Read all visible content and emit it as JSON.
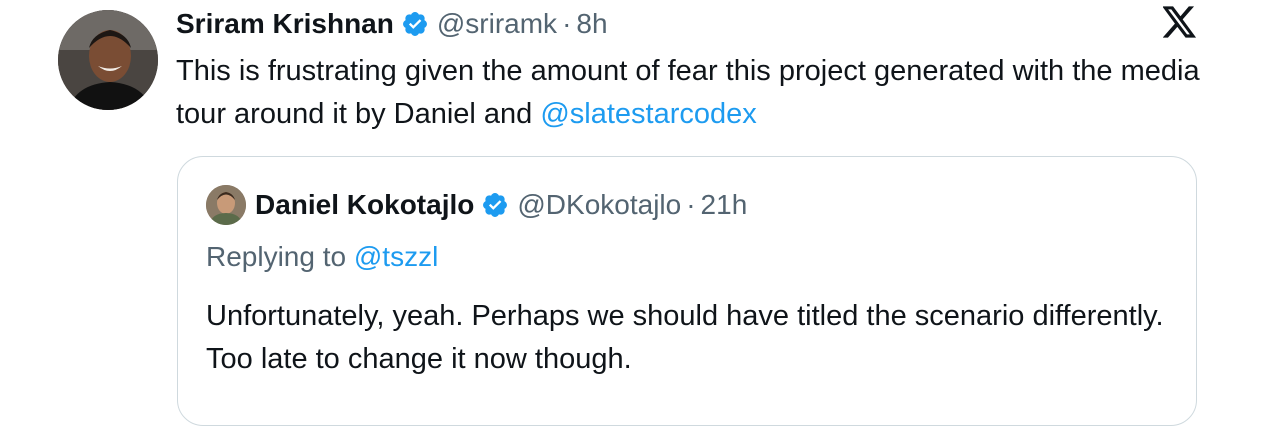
{
  "tweet": {
    "author_name": "Sriram Krishnan",
    "handle": "@sriramk",
    "separator": "·",
    "time": "8h",
    "text_before": "This is frustrating given the amount of fear this project generated with the media tour around it by Daniel and ",
    "mention": "@slatestarcodex",
    "verified_icon": "verified-badge-icon",
    "platform_icon": "x-logo-icon"
  },
  "quote": {
    "author_name": "Daniel Kokotajlo",
    "handle": "@DKokotajlo",
    "separator": "·",
    "time": "21h",
    "replying_label": "Replying to ",
    "replying_to": "@tszzl",
    "text": "Unfortunately, yeah. Perhaps we should have titled the scenario differently. Too late to change it now though."
  },
  "colors": {
    "link": "#1d9bf0",
    "verified": "#1d9bf0",
    "text": "#0f1419",
    "muted": "#536471",
    "border": "#cfd9de"
  }
}
